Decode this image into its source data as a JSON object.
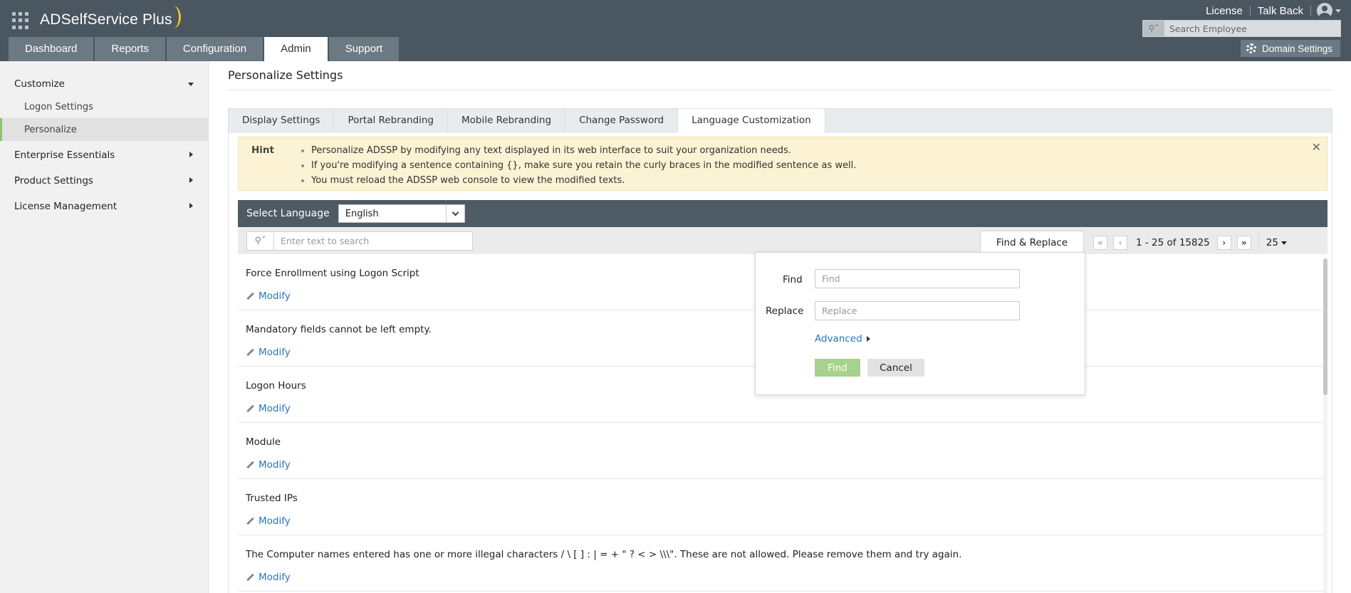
{
  "app": {
    "logo_text": "ADSelfService Plus",
    "top_links": [
      "License",
      "Talk Back"
    ],
    "search_placeholder": "Search Employee",
    "nav_tabs": [
      {
        "label": "Dashboard",
        "active": false
      },
      {
        "label": "Reports",
        "active": false
      },
      {
        "label": "Configuration",
        "active": false
      },
      {
        "label": "Admin",
        "active": true
      },
      {
        "label": "Support",
        "active": false
      }
    ],
    "domain_settings": "Domain Settings"
  },
  "sidebar": {
    "sections": [
      {
        "label": "Customize",
        "expanded": true
      },
      {
        "label": "Enterprise Essentials",
        "expanded": false
      },
      {
        "label": "Product Settings",
        "expanded": false
      },
      {
        "label": "License Management",
        "expanded": false
      }
    ],
    "items": [
      {
        "label": "Logon Settings",
        "active": false
      },
      {
        "label": "Personalize",
        "active": true
      }
    ]
  },
  "main": {
    "title": "Personalize Settings",
    "tabs": [
      {
        "label": "Display Settings",
        "active": false
      },
      {
        "label": "Portal Rebranding",
        "active": false
      },
      {
        "label": "Mobile Rebranding",
        "active": false
      },
      {
        "label": "Change Password",
        "active": false
      },
      {
        "label": "Language Customization",
        "active": true
      }
    ],
    "hint": {
      "label": "Hint",
      "items": [
        "Personalize ADSSP by modifying any text displayed in its web interface to suit your organization needs.",
        "If you're modifying a sentence containing {}, make sure you retain the curly braces in the modified sentence as well.",
        "You must reload the ADSSP web console to view the modified texts."
      ]
    },
    "language": {
      "label": "Select Language",
      "selected": "English"
    },
    "toolbar": {
      "search_placeholder": "Enter text to search",
      "find_replace_tab": "Find & Replace",
      "pagination": "1 - 25 of 15825",
      "per_page": "25"
    },
    "modify_label": "Modify",
    "rows": [
      "Force Enrollment using Logon Script",
      "Mandatory fields cannot be left empty.",
      "Logon Hours",
      "Module",
      "Trusted IPs",
      "The Computer names entered has one or more illegal characters / \\ [ ] : | = + \" ? < > \\\\\\\". These are not allowed. Please remove them and try again."
    ]
  },
  "find_replace": {
    "find_label": "Find",
    "find_placeholder": "Find",
    "replace_label": "Replace",
    "replace_placeholder": "Replace",
    "advanced": "Advanced",
    "find_button": "Find",
    "cancel_button": "Cancel"
  },
  "colors": {
    "header_bg": "#4a5660",
    "nav_tab_bg": "#6b7983",
    "accent_green": "#8cc56b",
    "find_button_bg": "#a7d28d",
    "link_blue": "#2a74b8",
    "hint_bg": "#fbf3d3"
  },
  "icons": [
    "apps-grid-icon",
    "user-avatar-icon",
    "search-icon",
    "gear-icon",
    "close-icon",
    "chevron-down-icon",
    "pencil-icon",
    "first-page-icon",
    "prev-page-icon",
    "next-page-icon",
    "last-page-icon"
  ]
}
